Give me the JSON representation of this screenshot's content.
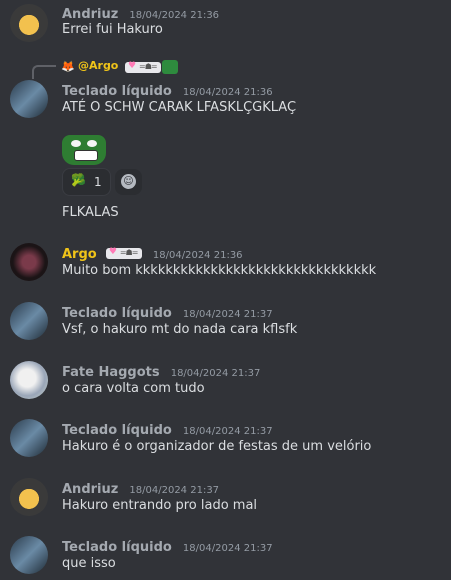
{
  "messages": [
    {
      "author": "Andriuz",
      "time": "18/04/2024 21:36",
      "text": "Errei fui Hakuro"
    },
    {
      "author": "Teclado líquido",
      "time": "18/04/2024 21:36",
      "text": "ATÉ O SCHW CARAK LFASKLÇGKLAÇ",
      "text2": "FLKALAS",
      "reply": {
        "author": "@Argo"
      },
      "reaction": {
        "emoji": "🥦",
        "count": "1"
      }
    },
    {
      "author": "Argo",
      "time": "18/04/2024 21:36",
      "text": "Muito bom kkkkkkkkkkkkkkkkkkkkkkkkkkkkkkkk"
    },
    {
      "author": "Teclado líquido",
      "time": "18/04/2024 21:37",
      "text": "Vsf, o hakuro mt do nada cara kflsfk"
    },
    {
      "author": "Fate Haggots",
      "time": "18/04/2024 21:37",
      "text": "o cara volta com tudo"
    },
    {
      "author": "Teclado líquido",
      "time": "18/04/2024 21:37",
      "text": "Hakuro é o organizador de festas de um velório"
    },
    {
      "author": "Andriuz",
      "time": "18/04/2024 21:37",
      "text": "Hakuro entrando pro lado mal"
    },
    {
      "author": "Teclado líquido",
      "time": "18/04/2024 21:37",
      "text": "que isso"
    }
  ],
  "colors": {
    "background": "#313338",
    "username_default": "#a4a9b0",
    "username_argo": "#f0c419",
    "timestamp": "#949ba4"
  },
  "icons": {
    "reply": "reply-arrow-icon",
    "add_reaction": "smile-icon"
  }
}
